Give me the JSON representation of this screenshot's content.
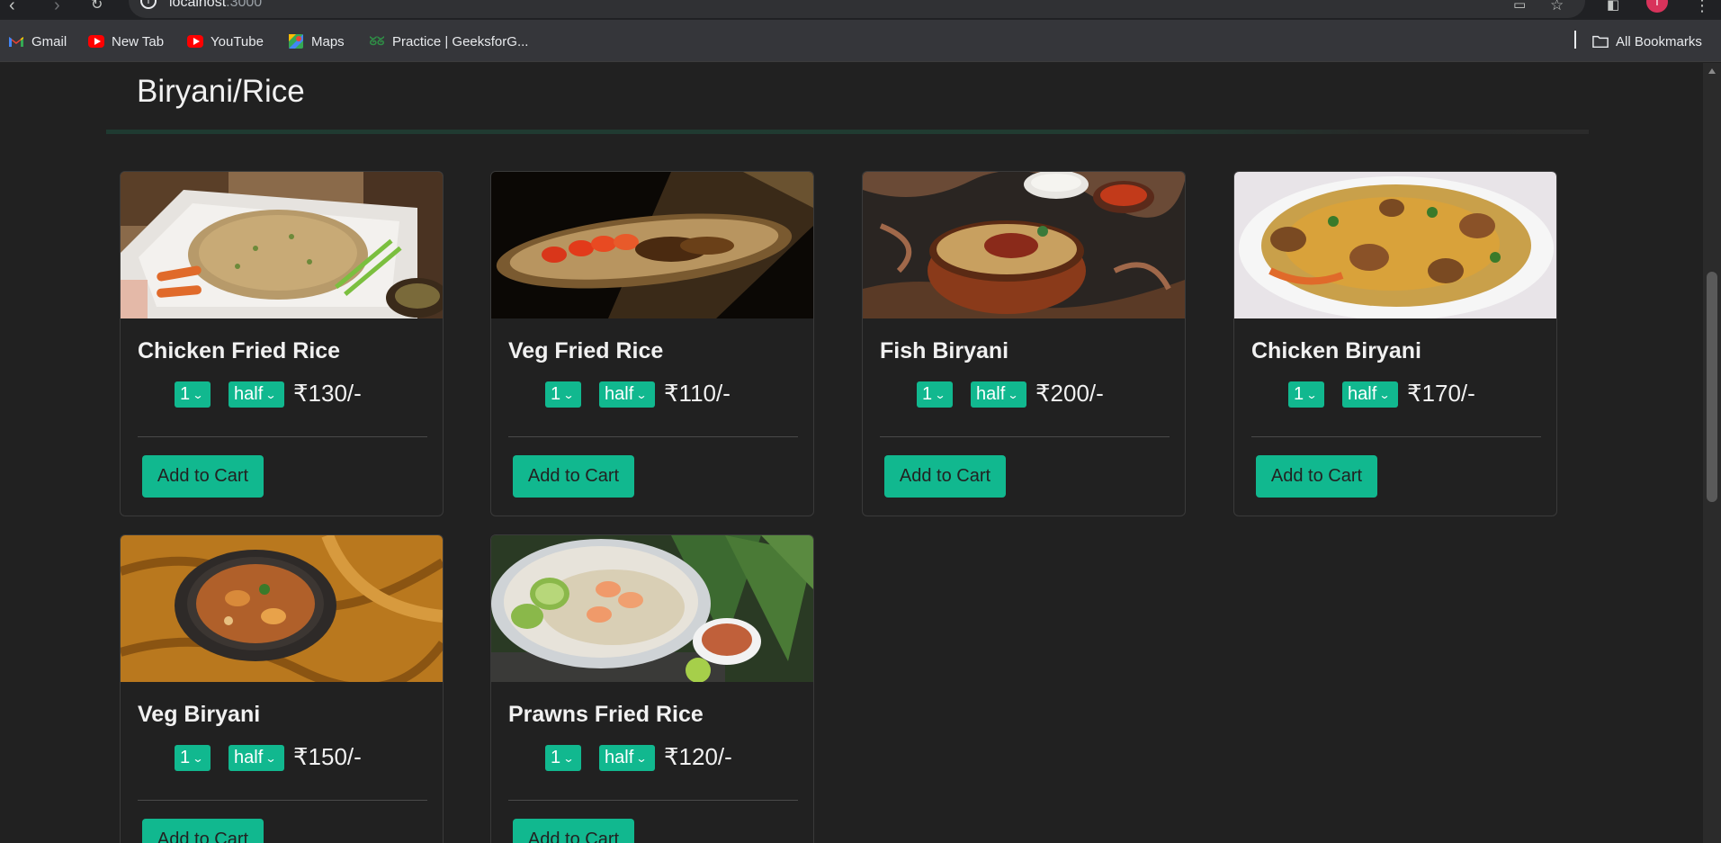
{
  "browser": {
    "url_host": "localhost",
    "url_port": ":3000",
    "profile_initial": "T"
  },
  "bookmarks": [
    {
      "label": "Gmail",
      "icon": "gmail-icon"
    },
    {
      "label": "New Tab",
      "icon": "youtube-icon"
    },
    {
      "label": "YouTube",
      "icon": "youtube-icon"
    },
    {
      "label": "Maps",
      "icon": "maps-icon"
    },
    {
      "label": "Practice | GeeksforG...",
      "icon": "geeksforgeeks-icon"
    }
  ],
  "all_bookmarks_label": "All Bookmarks",
  "section": {
    "title": "Biryani/Rice"
  },
  "colors": {
    "accent": "#11b88f",
    "background": "#212121"
  },
  "items": [
    {
      "name": "Chicken Fried Rice",
      "qty": "1",
      "size": "half",
      "price": "₹130/-",
      "cta": "Add to Cart"
    },
    {
      "name": "Veg Fried Rice",
      "qty": "1",
      "size": "half",
      "price": "₹110/-",
      "cta": "Add to Cart"
    },
    {
      "name": "Fish Biryani",
      "qty": "1",
      "size": "half",
      "price": "₹200/-",
      "cta": "Add to Cart"
    },
    {
      "name": "Chicken Biryani",
      "qty": "1",
      "size": "half",
      "price": "₹170/-",
      "cta": "Add to Cart"
    },
    {
      "name": "Veg Biryani",
      "qty": "1",
      "size": "half",
      "price": "₹150/-",
      "cta": "Add to Cart"
    },
    {
      "name": "Prawns Fried Rice",
      "qty": "1",
      "size": "half",
      "price": "₹120/-",
      "cta": "Add to Cart"
    }
  ]
}
